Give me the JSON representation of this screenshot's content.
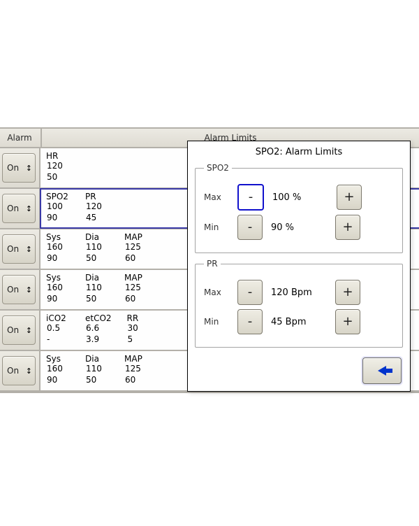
{
  "header": {
    "alarm_label": "Alarm",
    "main_title": "Alarm Limits"
  },
  "alarm_button_text": "On",
  "rows": [
    {
      "id": "hr",
      "selected": false,
      "cols": [
        {
          "label": "HR",
          "max": "120",
          "min": "50"
        }
      ]
    },
    {
      "id": "spo2",
      "selected": true,
      "cols": [
        {
          "label": "SPO2",
          "max": "100",
          "min": "90"
        },
        {
          "label": "PR",
          "max": "120",
          "min": "45"
        }
      ]
    },
    {
      "id": "bp1",
      "selected": false,
      "cols": [
        {
          "label": "Sys",
          "max": "160",
          "min": "90"
        },
        {
          "label": "Dia",
          "max": "110",
          "min": "50"
        },
        {
          "label": "MAP",
          "max": "125",
          "min": "60"
        }
      ]
    },
    {
      "id": "bp2",
      "selected": false,
      "cols": [
        {
          "label": "Sys",
          "max": "160",
          "min": "90"
        },
        {
          "label": "Dia",
          "max": "110",
          "min": "50"
        },
        {
          "label": "MAP",
          "max": "125",
          "min": "60"
        }
      ]
    },
    {
      "id": "co2",
      "selected": false,
      "cols": [
        {
          "label": "iCO2",
          "max": "0.5",
          "min": "-"
        },
        {
          "label": "etCO2",
          "max": "6.6",
          "min": "3.9"
        },
        {
          "label": "RR",
          "max": "30",
          "min": "5"
        }
      ]
    },
    {
      "id": "bp3",
      "selected": false,
      "cols": [
        {
          "label": "Sys",
          "max": "160",
          "min": "90"
        },
        {
          "label": "Dia",
          "max": "110",
          "min": "50"
        },
        {
          "label": "MAP",
          "max": "125",
          "min": "60"
        }
      ]
    }
  ],
  "dialog": {
    "title": "SPO2: Alarm Limits",
    "minus_label": "-",
    "plus_label": "+",
    "groups": [
      {
        "legend": "SPO2",
        "rows": [
          {
            "label": "Max",
            "value": "100 %",
            "focused": true
          },
          {
            "label": "Min",
            "value": "90 %",
            "focused": false
          }
        ]
      },
      {
        "legend": "PR",
        "rows": [
          {
            "label": "Max",
            "value": "120 Bpm",
            "focused": false
          },
          {
            "label": "Min",
            "value": "45 Bpm",
            "focused": false
          }
        ]
      }
    ]
  }
}
